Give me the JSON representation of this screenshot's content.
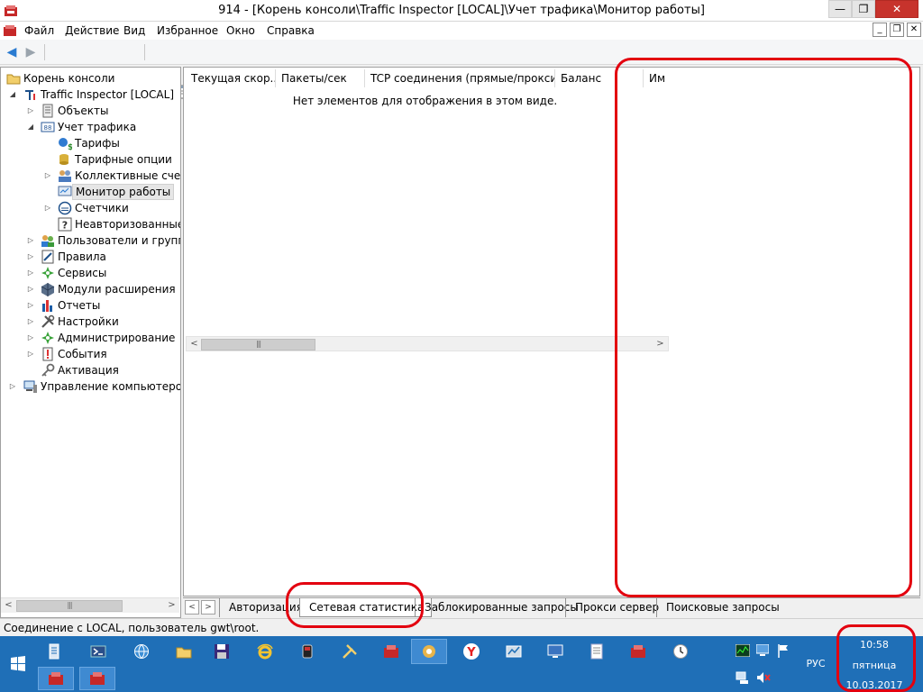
{
  "window": {
    "title": "914 - [Корень консоли\\Traffic Inspector [LOCAL]\\Учет трафика\\Монитор работы]",
    "min_glyph": "—",
    "max_glyph": "❐",
    "close_glyph": "✕"
  },
  "menu": {
    "items": [
      "Файл",
      "Действие",
      "Вид",
      "Избранное",
      "Окно",
      "Справка"
    ]
  },
  "tree": {
    "items": [
      {
        "label": "Корень консоли",
        "icon": "folder-icon"
      },
      {
        "label": "Traffic Inspector [LOCAL]",
        "icon": "traffic-inspector-icon"
      },
      {
        "label": "Объекты",
        "icon": "objects-icon"
      },
      {
        "label": "Учет трафика",
        "icon": "traffic-accounting-icon"
      },
      {
        "label": "Тарифы",
        "icon": "tariffs-icon"
      },
      {
        "label": "Тарифные опции",
        "icon": "tariff-options-icon"
      },
      {
        "label": "Коллективные счета",
        "icon": "group-accounts-icon"
      },
      {
        "label": "Монитор работы",
        "icon": "monitor-icon"
      },
      {
        "label": "Счетчики",
        "icon": "counters-icon"
      },
      {
        "label": "Неавторизованные IP",
        "icon": "unauthorized-ip-icon"
      },
      {
        "label": "Пользователи и группы",
        "icon": "users-groups-icon"
      },
      {
        "label": "Правила",
        "icon": "rules-icon"
      },
      {
        "label": "Сервисы",
        "icon": "services-icon"
      },
      {
        "label": "Модули расширения",
        "icon": "extensions-icon"
      },
      {
        "label": "Отчеты",
        "icon": "reports-icon"
      },
      {
        "label": "Настройки",
        "icon": "settings-icon"
      },
      {
        "label": "Администрирование",
        "icon": "admin-icon"
      },
      {
        "label": "События",
        "icon": "events-icon"
      },
      {
        "label": "Активация",
        "icon": "activation-key-icon"
      },
      {
        "label": "Управление компьютером (локальным)",
        "icon": "computer-management-icon"
      }
    ]
  },
  "columns": [
    "Текущая скор...",
    "Пакеты/сек",
    "TCP соединения (прямые/прокси)",
    "Баланс",
    "Им"
  ],
  "empty_message": "Нет элементов для отображения в этом виде.",
  "tabs": [
    "Авторизация",
    "Сетевая статистика",
    "Заблокированные запросы",
    "Прокси сервер",
    "Поисковые запросы"
  ],
  "active_tab": "Сетевая статистика",
  "status": "Соединение с LOCAL, пользователь gwt\\root.",
  "tray": {
    "lang": "РУС",
    "time": "10:58",
    "day": "пятница",
    "date": "10.03.2017"
  },
  "colors": {
    "taskbar": "#1f6fb7",
    "close_button": "#c7332c",
    "annotation": "#e3000f"
  }
}
